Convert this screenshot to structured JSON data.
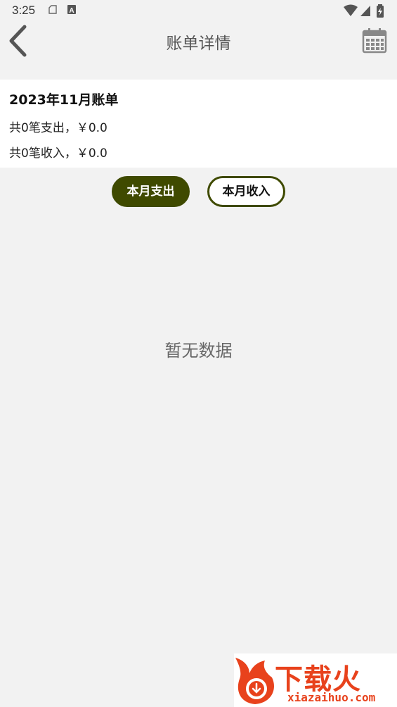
{
  "status_bar": {
    "time": "3:25"
  },
  "header": {
    "title": "账单详情",
    "back_icon": "chevron-left-icon",
    "calendar_icon": "calendar-icon"
  },
  "summary": {
    "title": "2023年11月账单",
    "expense_line": "共0笔支出，￥0.0",
    "income_line": "共0笔收入，￥0.0"
  },
  "tabs": {
    "expense_label": "本月支出",
    "income_label": "本月收入",
    "active": "expense"
  },
  "empty_state": {
    "text": "暂无数据"
  },
  "watermark": {
    "brand": "下载火",
    "url": "xiazaihuo.com"
  },
  "colors": {
    "accent": "#3f4a00",
    "background": "#f2f2f2",
    "watermark": "#e8421c"
  }
}
